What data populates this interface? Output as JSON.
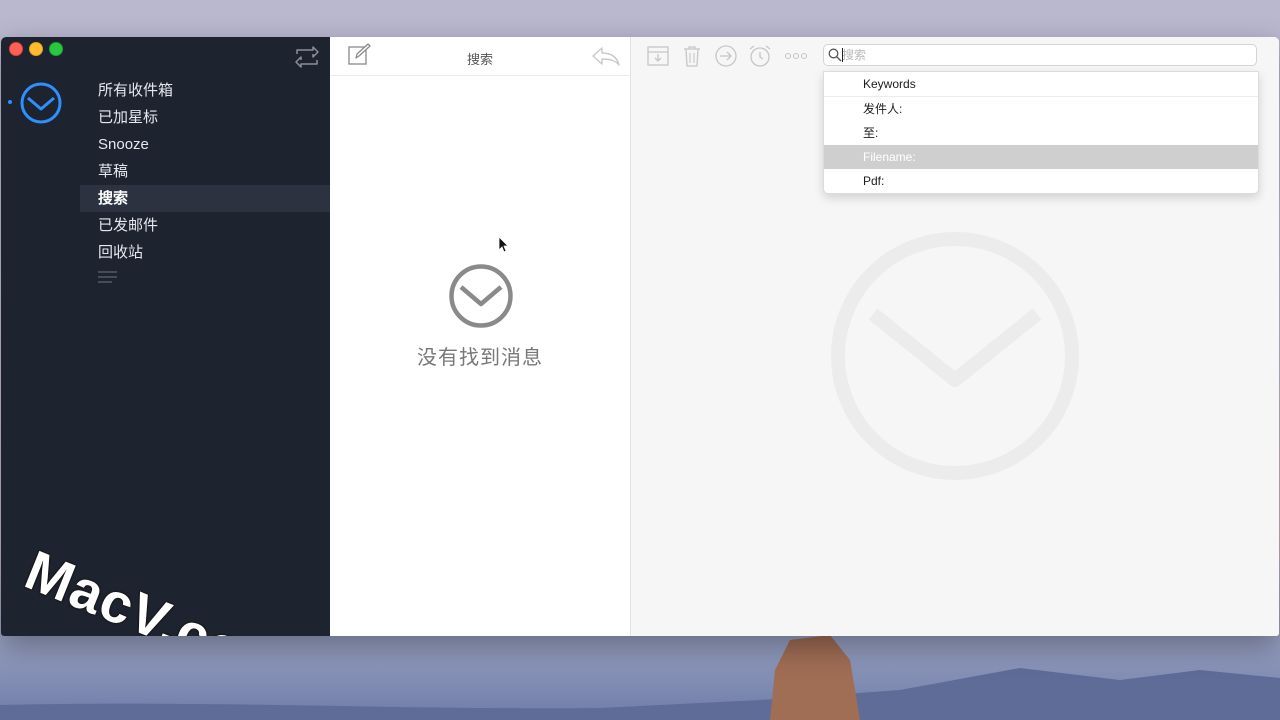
{
  "sidebar": {
    "items": [
      {
        "label": "所有收件箱"
      },
      {
        "label": "已加星标"
      },
      {
        "label": "Snooze"
      },
      {
        "label": "草稿"
      },
      {
        "label": "搜索"
      },
      {
        "label": "已发邮件"
      },
      {
        "label": "回收站"
      }
    ],
    "active_index": 4,
    "watermark": "MacV.com"
  },
  "list": {
    "title": "搜索",
    "empty_message": "没有找到消息"
  },
  "reader": {
    "search": {
      "placeholder": "搜索",
      "value": ""
    },
    "dropdown": {
      "options": [
        {
          "label": "Keywords"
        },
        {
          "label": "发件人:"
        },
        {
          "label": "至:"
        },
        {
          "label": "Filename:"
        },
        {
          "label": "Pdf:"
        }
      ],
      "selected_index": 3
    }
  },
  "colors": {
    "accent": "#2f8fff",
    "sidebar_bg": "#1e2330",
    "selected_option": "#cfcfcf"
  },
  "icons": [
    "sync-icon",
    "account-mail-icon",
    "menu-lines-icon",
    "compose-icon",
    "reply-icon",
    "archive-icon",
    "trash-icon",
    "move-icon",
    "snooze-alarm-icon",
    "more-icon",
    "search-icon",
    "empty-mail-icon"
  ]
}
